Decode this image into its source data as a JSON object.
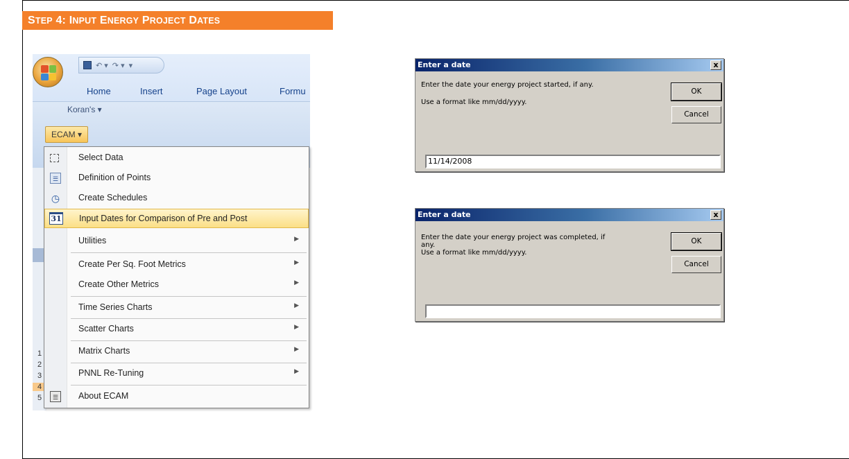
{
  "banner": {
    "step_word": "S",
    "step_rest": "TEP",
    "num": "4:",
    "w1": "I",
    "w1r": "NPUT",
    "w2": "E",
    "w2r": "NERGY",
    "w3": "P",
    "w3r": "ROJECT",
    "w4": "D",
    "w4r": "ATES"
  },
  "excel": {
    "tabs": [
      "Home",
      "Insert",
      "Page Layout",
      "Formu"
    ],
    "addin_label": "Koran's ▾",
    "ecam_button": "ECAM ▾",
    "row_headers": [
      "1",
      "2",
      "3",
      "4",
      "5"
    ]
  },
  "menu": {
    "items": [
      {
        "label": "Select Data",
        "icon": "select-data-icon",
        "arrow": ""
      },
      {
        "label": "Definition of Points",
        "icon": "list-icon",
        "arrow": ""
      },
      {
        "label": "Create Schedules",
        "icon": "clock-icon",
        "arrow": ""
      },
      {
        "label": "Input Dates for Comparison of Pre and Post",
        "icon": "calendar-icon",
        "arrow": ""
      },
      {
        "label": "Utilities",
        "icon": "",
        "arrow": "▶"
      },
      {
        "label": "Create Per Sq. Foot Metrics",
        "icon": "",
        "arrow": "▶"
      },
      {
        "label": "Create Other Metrics",
        "icon": "",
        "arrow": "▶"
      },
      {
        "label": "Time Series Charts",
        "icon": "",
        "arrow": "▶"
      },
      {
        "label": "Scatter Charts",
        "icon": "",
        "arrow": "▶"
      },
      {
        "label": "Matrix Charts",
        "icon": "",
        "arrow": "▶"
      },
      {
        "label": "PNNL Re-Tuning",
        "icon": "",
        "arrow": "▶"
      },
      {
        "label": "About ECAM",
        "icon": "document-icon",
        "arrow": ""
      }
    ],
    "calendar_glyph": "31"
  },
  "dialog1": {
    "title": "Enter a date",
    "prompt_line1": "Enter the date your energy project started, if any.",
    "prompt_line2": "Use a format like mm/dd/yyyy.",
    "ok_label": "OK",
    "cancel_label": "Cancel",
    "input_value": "11/14/2008",
    "close_glyph": "x"
  },
  "dialog2": {
    "title": "Enter a date",
    "prompt_line1": "Enter the date your energy project was completed, if",
    "prompt_line1b": "any.",
    "prompt_line2": "Use a format like mm/dd/yyyy.",
    "ok_label": "OK",
    "cancel_label": "Cancel",
    "input_value": "",
    "close_glyph": "x"
  },
  "colors": {
    "banner": "#f4802a",
    "title_bar": "#0a246a",
    "menu_highlight": "#fbdf86"
  }
}
